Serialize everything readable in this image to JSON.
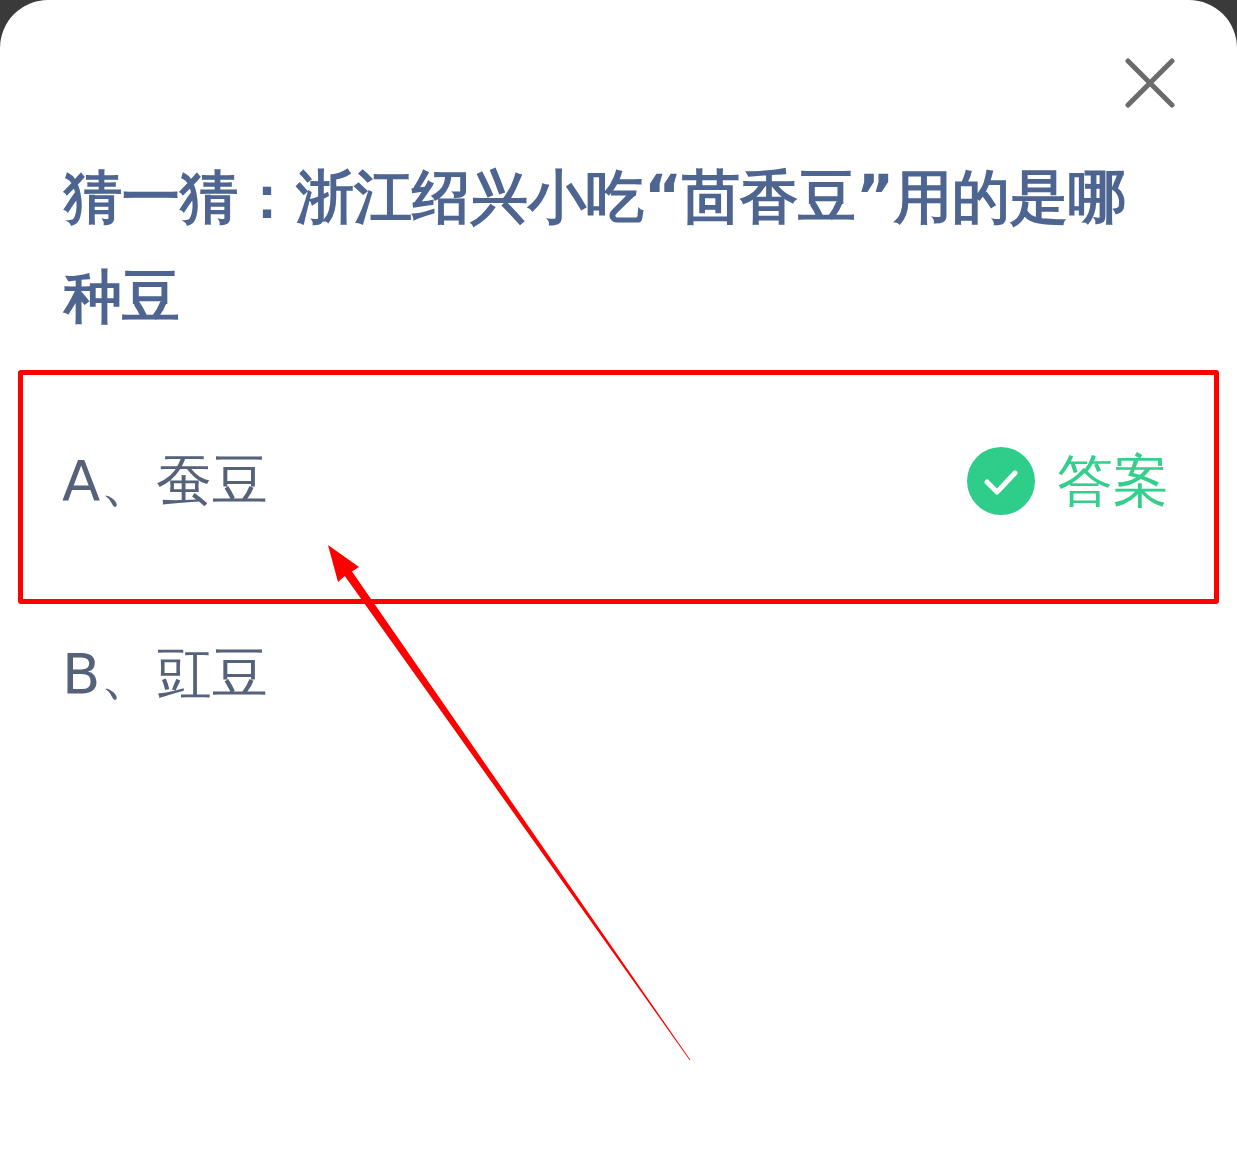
{
  "question": "猜一猜：浙江绍兴小吃“茴香豆”用的是哪种豆",
  "options": [
    {
      "text": "A、蚕豆",
      "answer": true,
      "answer_label": "答案",
      "highlighted": true
    },
    {
      "text": "B、豇豆",
      "answer": false,
      "highlighted": false
    }
  ]
}
